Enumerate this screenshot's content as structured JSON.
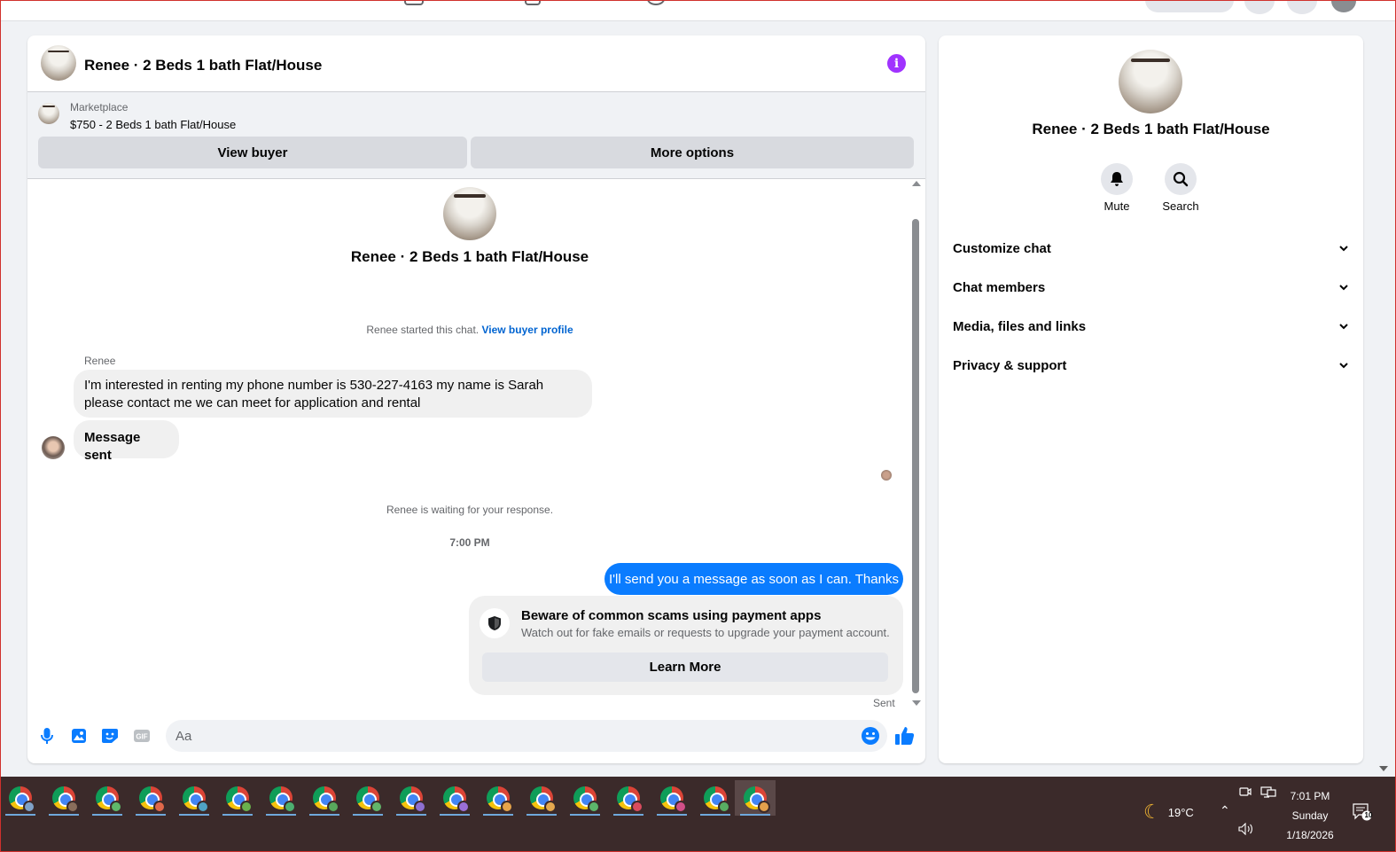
{
  "colors": {
    "accent": "#0a7cff",
    "info": "#a033ff",
    "link": "#0064d1",
    "taskbar": "#3b2a2a"
  },
  "chat": {
    "title": "Renee · 2 Beds 1 bath Flat/House",
    "marketplace": {
      "label": "Marketplace",
      "listing": "$750 - 2 Beds 1 bath Flat/House"
    },
    "buttons": {
      "view_buyer": "View buyer",
      "more_options": "More options"
    },
    "intro_name": "Renee · 2 Beds 1 bath Flat/House",
    "started_text": "Renee started this chat.",
    "started_link": "View buyer profile",
    "sender_name": "Renee",
    "messages_in": [
      "I'm interested in renting my phone number is 530-227-4163 my name is Sarah please contact me we can meet for application and rental",
      "Message sent"
    ],
    "waiting": "Renee is waiting for your response.",
    "timestamp": "7:00 PM",
    "message_out": "I'll send you a message as soon as I can. Thanks",
    "scam_card": {
      "title": "Beware of common scams using payment apps",
      "subtitle": "Watch out for fake emails or requests to upgrade your payment account.",
      "button": "Learn More",
      "icon": "shield-icon"
    },
    "sent_status": "Sent",
    "composer": {
      "placeholder": "Aa"
    }
  },
  "info_panel": {
    "title": "Renee · 2 Beds 1 bath Flat/House",
    "actions": [
      {
        "label": "Mute",
        "icon": "bell-icon"
      },
      {
        "label": "Search",
        "icon": "search-icon"
      }
    ],
    "sections": [
      "Customize chat",
      "Chat members",
      "Media, files and links",
      "Privacy & support"
    ]
  },
  "taskbar": {
    "weather": {
      "temp": "19°C",
      "icon": "moon-icon"
    },
    "time": "7:01 PM",
    "day": "Sunday",
    "date": "1/18/2026",
    "notifications": "10",
    "apps": [
      "chrome",
      "chrome",
      "chrome",
      "chrome",
      "chrome",
      "chrome",
      "chrome",
      "chrome",
      "chrome",
      "chrome",
      "chrome",
      "chrome",
      "chrome",
      "chrome",
      "chrome",
      "chrome",
      "chrome",
      "chrome"
    ]
  }
}
